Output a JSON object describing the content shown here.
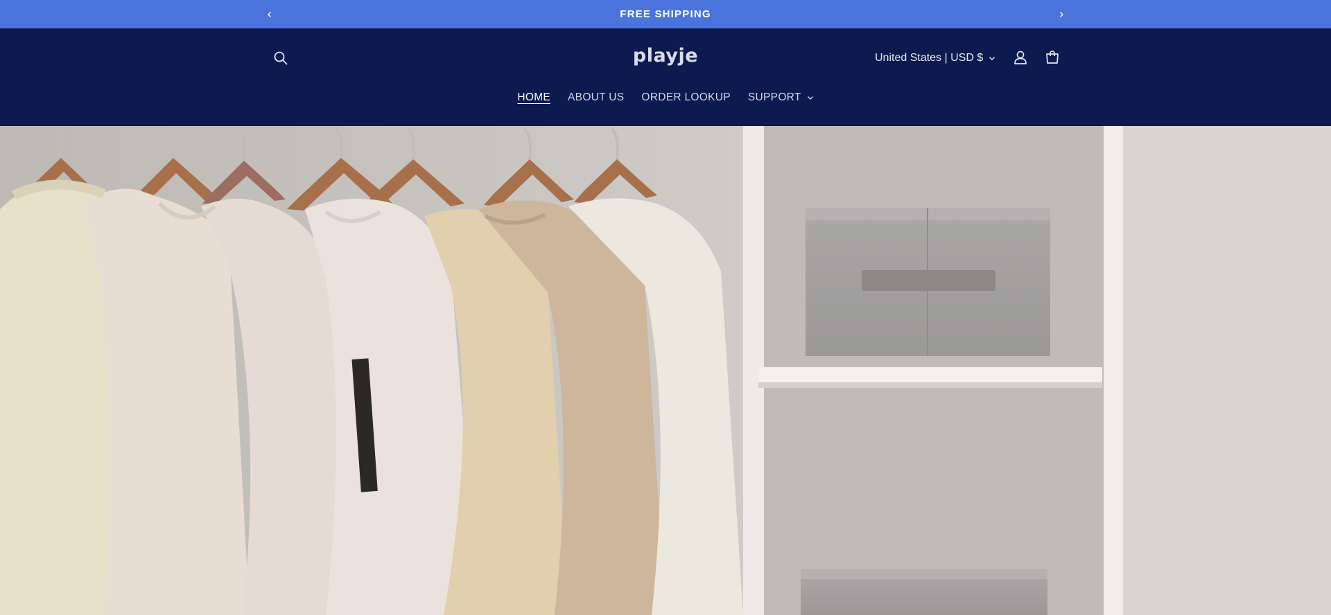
{
  "announcement": {
    "text": "FREE SHIPPING"
  },
  "header": {
    "logo": "playje",
    "locale": "United States | USD $"
  },
  "nav": {
    "items": [
      {
        "label": "HOME"
      },
      {
        "label": "ABOUT US"
      },
      {
        "label": "ORDER LOOKUP"
      },
      {
        "label": "SUPPORT"
      }
    ]
  },
  "icons": {
    "prev": "chevron-left-icon",
    "next": "chevron-right-icon",
    "search": "search-icon",
    "account": "user-icon",
    "cart": "cart-icon",
    "dropdown": "chevron-down-icon"
  },
  "colors": {
    "announcement_bg": "#4a74dc",
    "header_bg": "#0d1a4f",
    "text_light": "#e6e8f0"
  }
}
